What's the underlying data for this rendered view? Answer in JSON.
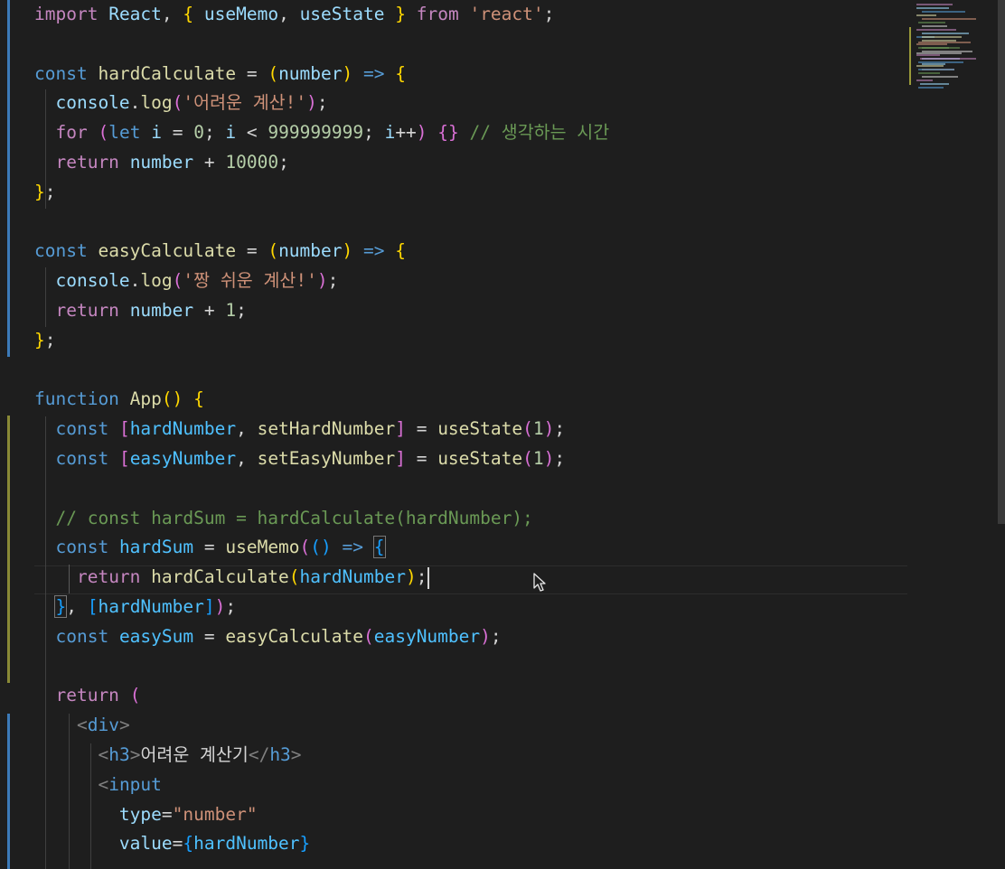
{
  "editor": {
    "language": "javascript",
    "code_lines": [
      [
        [
          "import",
          "kw-ctl"
        ],
        [
          " ",
          "txt"
        ],
        [
          "React",
          "var"
        ],
        [
          ", ",
          "txt"
        ],
        [
          "{",
          "b1"
        ],
        [
          " ",
          "txt"
        ],
        [
          "useMemo",
          "var"
        ],
        [
          ", ",
          "txt"
        ],
        [
          "useState",
          "var"
        ],
        [
          " ",
          "txt"
        ],
        [
          "}",
          "b1"
        ],
        [
          " ",
          "txt"
        ],
        [
          "from",
          "kw-ctl"
        ],
        [
          " ",
          "txt"
        ],
        [
          "'react'",
          "str"
        ],
        [
          ";",
          "txt"
        ]
      ],
      [],
      [
        [
          "const",
          "kw"
        ],
        [
          " ",
          "txt"
        ],
        [
          "hardCalculate",
          "fn"
        ],
        [
          " = ",
          "txt"
        ],
        [
          "(",
          "b1"
        ],
        [
          "number",
          "var"
        ],
        [
          ")",
          "b1"
        ],
        [
          " ",
          "txt"
        ],
        [
          "=>",
          "kw"
        ],
        [
          " ",
          "txt"
        ],
        [
          "{",
          "b1"
        ]
      ],
      [
        [
          "  ",
          "txt"
        ],
        [
          "console",
          "var"
        ],
        [
          ".",
          "txt"
        ],
        [
          "log",
          "fn"
        ],
        [
          "(",
          "b2"
        ],
        [
          "'어려운 계산!'",
          "str"
        ],
        [
          ")",
          "b2"
        ],
        [
          ";",
          "txt"
        ]
      ],
      [
        [
          "  ",
          "txt"
        ],
        [
          "for",
          "kw-ctl"
        ],
        [
          " ",
          "txt"
        ],
        [
          "(",
          "b2"
        ],
        [
          "let",
          "kw"
        ],
        [
          " ",
          "txt"
        ],
        [
          "i",
          "var"
        ],
        [
          " = ",
          "txt"
        ],
        [
          "0",
          "num"
        ],
        [
          "; ",
          "txt"
        ],
        [
          "i",
          "var"
        ],
        [
          " < ",
          "txt"
        ],
        [
          "999999999",
          "num"
        ],
        [
          "; ",
          "txt"
        ],
        [
          "i",
          "var"
        ],
        [
          "++",
          "txt"
        ],
        [
          ")",
          "b2"
        ],
        [
          " ",
          "txt"
        ],
        [
          "{}",
          "b2"
        ],
        [
          " ",
          "txt"
        ],
        [
          "// 생각하는 시간",
          "cmt"
        ]
      ],
      [
        [
          "  ",
          "txt"
        ],
        [
          "return",
          "kw-ctl"
        ],
        [
          " ",
          "txt"
        ],
        [
          "number",
          "var"
        ],
        [
          " + ",
          "txt"
        ],
        [
          "10000",
          "num"
        ],
        [
          ";",
          "txt"
        ]
      ],
      [
        [
          "}",
          "b1"
        ],
        [
          ";",
          "txt"
        ]
      ],
      [],
      [
        [
          "const",
          "kw"
        ],
        [
          " ",
          "txt"
        ],
        [
          "easyCalculate",
          "fn"
        ],
        [
          " = ",
          "txt"
        ],
        [
          "(",
          "b1"
        ],
        [
          "number",
          "var"
        ],
        [
          ")",
          "b1"
        ],
        [
          " ",
          "txt"
        ],
        [
          "=>",
          "kw"
        ],
        [
          " ",
          "txt"
        ],
        [
          "{",
          "b1"
        ]
      ],
      [
        [
          "  ",
          "txt"
        ],
        [
          "console",
          "var"
        ],
        [
          ".",
          "txt"
        ],
        [
          "log",
          "fn"
        ],
        [
          "(",
          "b2"
        ],
        [
          "'짱 쉬운 계산!'",
          "str"
        ],
        [
          ")",
          "b2"
        ],
        [
          ";",
          "txt"
        ]
      ],
      [
        [
          "  ",
          "txt"
        ],
        [
          "return",
          "kw-ctl"
        ],
        [
          " ",
          "txt"
        ],
        [
          "number",
          "var"
        ],
        [
          " + ",
          "txt"
        ],
        [
          "1",
          "num"
        ],
        [
          ";",
          "txt"
        ]
      ],
      [
        [
          "}",
          "b1"
        ],
        [
          ";",
          "txt"
        ]
      ],
      [],
      [
        [
          "function",
          "kw"
        ],
        [
          " ",
          "txt"
        ],
        [
          "App",
          "fn"
        ],
        [
          "()",
          "b1"
        ],
        [
          " ",
          "txt"
        ],
        [
          "{",
          "b1"
        ]
      ],
      [
        [
          "  ",
          "txt"
        ],
        [
          "const",
          "kw"
        ],
        [
          " ",
          "txt"
        ],
        [
          "[",
          "b2"
        ],
        [
          "hardNumber",
          "const"
        ],
        [
          ", ",
          "txt"
        ],
        [
          "setHardNumber",
          "fn"
        ],
        [
          "]",
          "b2"
        ],
        [
          " = ",
          "txt"
        ],
        [
          "useState",
          "fn"
        ],
        [
          "(",
          "b2"
        ],
        [
          "1",
          "num"
        ],
        [
          ")",
          "b2"
        ],
        [
          ";",
          "txt"
        ]
      ],
      [
        [
          "  ",
          "txt"
        ],
        [
          "const",
          "kw"
        ],
        [
          " ",
          "txt"
        ],
        [
          "[",
          "b2"
        ],
        [
          "easyNumber",
          "const"
        ],
        [
          ", ",
          "txt"
        ],
        [
          "setEasyNumber",
          "fn"
        ],
        [
          "]",
          "b2"
        ],
        [
          " = ",
          "txt"
        ],
        [
          "useState",
          "fn"
        ],
        [
          "(",
          "b2"
        ],
        [
          "1",
          "num"
        ],
        [
          ")",
          "b2"
        ],
        [
          ";",
          "txt"
        ]
      ],
      [],
      [
        [
          "  ",
          "txt"
        ],
        [
          "// const hardSum = hardCalculate(hardNumber);",
          "cmt"
        ]
      ],
      [
        [
          "  ",
          "txt"
        ],
        [
          "const",
          "kw"
        ],
        [
          " ",
          "txt"
        ],
        [
          "hardSum",
          "const"
        ],
        [
          " = ",
          "txt"
        ],
        [
          "useMemo",
          "fn"
        ],
        [
          "(",
          "b2"
        ],
        [
          "()",
          "b3"
        ],
        [
          " ",
          "txt"
        ],
        [
          "=>",
          "kw"
        ],
        [
          " ",
          "txt"
        ],
        [
          "{",
          "b3-box"
        ]
      ],
      [
        [
          "    ",
          "txt"
        ],
        [
          "return",
          "kw-ctl"
        ],
        [
          " ",
          "txt"
        ],
        [
          "hardCalculate",
          "fn"
        ],
        [
          "(",
          "b1"
        ],
        [
          "hardNumber",
          "const"
        ],
        [
          ")",
          "b1"
        ],
        [
          ";",
          "txt"
        ],
        [
          "",
          "caret"
        ]
      ],
      [
        [
          "  ",
          "txt"
        ],
        [
          "}",
          "b3-box"
        ],
        [
          ", ",
          "txt"
        ],
        [
          "[",
          "b3"
        ],
        [
          "hardNumber",
          "const"
        ],
        [
          "]",
          "b3"
        ],
        [
          ")",
          "b2"
        ],
        [
          ";",
          "txt"
        ]
      ],
      [
        [
          "  ",
          "txt"
        ],
        [
          "const",
          "kw"
        ],
        [
          " ",
          "txt"
        ],
        [
          "easySum",
          "const"
        ],
        [
          " = ",
          "txt"
        ],
        [
          "easyCalculate",
          "fn"
        ],
        [
          "(",
          "b2"
        ],
        [
          "easyNumber",
          "const"
        ],
        [
          ")",
          "b2"
        ],
        [
          ";",
          "txt"
        ]
      ],
      [],
      [
        [
          "  ",
          "txt"
        ],
        [
          "return",
          "kw-ctl"
        ],
        [
          " ",
          "txt"
        ],
        [
          "(",
          "b2"
        ]
      ],
      [
        [
          "    ",
          "txt"
        ],
        [
          "<",
          "punct"
        ],
        [
          "div",
          "tag"
        ],
        [
          ">",
          "punct"
        ]
      ],
      [
        [
          "      ",
          "txt"
        ],
        [
          "<",
          "punct"
        ],
        [
          "h3",
          "tag"
        ],
        [
          ">",
          "punct"
        ],
        [
          "어려운 계산기",
          "txt"
        ],
        [
          "</",
          "punct"
        ],
        [
          "h3",
          "tag"
        ],
        [
          ">",
          "punct"
        ]
      ],
      [
        [
          "      ",
          "txt"
        ],
        [
          "<",
          "punct"
        ],
        [
          "input",
          "tag"
        ]
      ],
      [
        [
          "        ",
          "txt"
        ],
        [
          "type",
          "var"
        ],
        [
          "=",
          "txt"
        ],
        [
          "\"number\"",
          "str"
        ]
      ],
      [
        [
          "        ",
          "txt"
        ],
        [
          "value",
          "var"
        ],
        [
          "=",
          "txt"
        ],
        [
          "{",
          "b3"
        ],
        [
          "hardNumber",
          "const"
        ],
        [
          "}",
          "b3"
        ]
      ]
    ],
    "colors": {
      "background": "#1e1e1e",
      "gutter_added": "#3c7ab8",
      "gutter_modified": "#9a9a3a"
    }
  },
  "minimap": {
    "visible": true
  }
}
